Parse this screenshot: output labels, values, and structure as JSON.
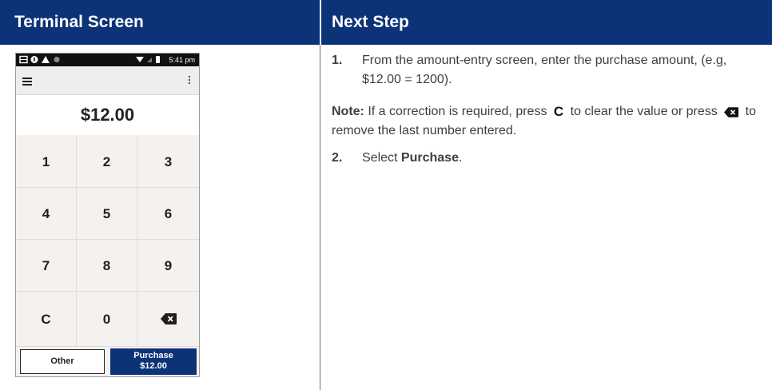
{
  "header": {
    "left_title": "Terminal Screen",
    "right_title": "Next Step"
  },
  "terminal": {
    "status_time": "5:41 pm",
    "amount": "$12.00",
    "keys": [
      "1",
      "2",
      "3",
      "4",
      "5",
      "6",
      "7",
      "8",
      "9",
      "C",
      "0"
    ],
    "backspace_icon": "backspace-icon",
    "other_label": "Other",
    "purchase_label": "Purchase",
    "purchase_amount": "$12.00",
    "colors": {
      "brand": "#0c3277",
      "keypad_bg": "#f4f1ef"
    }
  },
  "instructions": {
    "step1_num": "1.",
    "step1_text": "From the amount-entry screen, enter the purchase amount, (e.g, $12.00 = 1200).",
    "note_label": "Note:",
    "note_part1": "If a correction is required, press",
    "note_c_key": "C",
    "note_part2": "to clear the value or press",
    "note_part3": "to remove the last number entered.",
    "step2_num": "2.",
    "step2_prefix": "Select",
    "step2_bold": "Purchase",
    "step2_suffix": "."
  }
}
